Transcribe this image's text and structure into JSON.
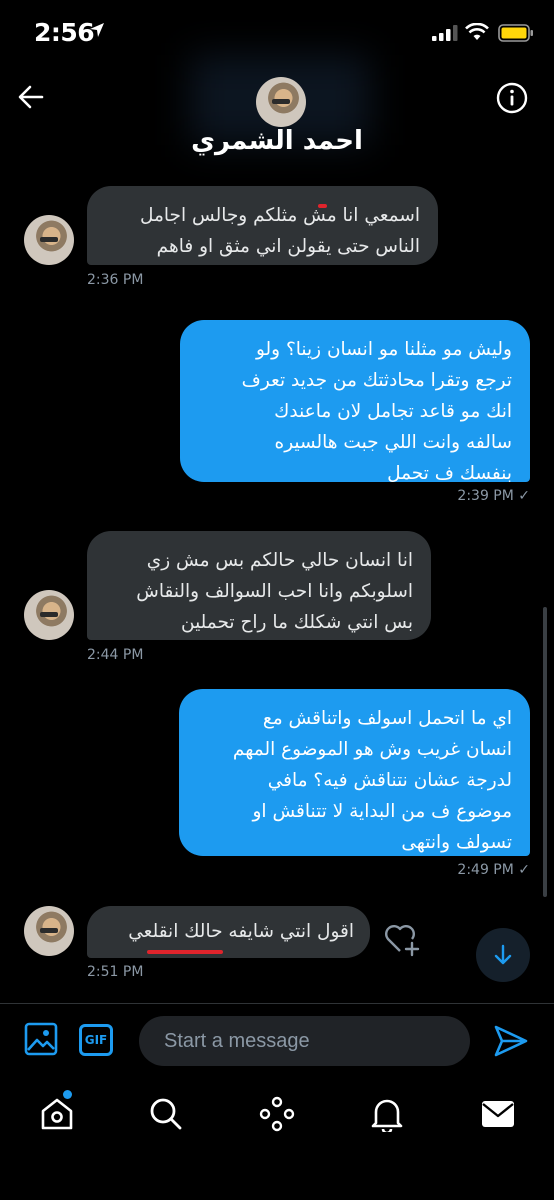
{
  "status_bar": {
    "time": "2:56"
  },
  "header": {
    "name": "احمد الشمري"
  },
  "messages": [
    {
      "side": "received",
      "text": "اسمعي انا مش مثلكم وجالس اجامل\nالناس حتى يقولن اني مثق او فاهم",
      "time": "2:36 PM"
    },
    {
      "side": "sent",
      "text": "وليش مو مثلنا مو انسان زينا؟ ولو\nترجع وتقرا محادثتك من جديد تعرف\nانك مو قاعد تجامل لان ماعندك\nسالفه وانت اللي جبت هالسيره\nبنفسك ف تحمل",
      "time": "2:39 PM ✓"
    },
    {
      "side": "received",
      "text": "انا انسان حالي حالكم بس مش زي\nاسلوبكم وانا احب السوالف والنقاش\nبس انتي شكلك ما راح تحملين",
      "time": "2:44 PM"
    },
    {
      "side": "sent",
      "text": "اي ما اتحمل اسولف واتناقش مع\nانسان غريب وش هو الموضوع المهم\nلدرجة عشان نتناقش فيه؟ مافي\nموضوع ف من البداية لا تتناقش او\nتسولف وانتهى",
      "time": "2:49 PM ✓"
    },
    {
      "side": "received",
      "text": "اقول انتي شايفه حالك انقلعي",
      "time": "2:51 PM"
    }
  ],
  "composer": {
    "placeholder": "Start a message",
    "gif_label": "GIF"
  },
  "tabs": [
    "home-icon",
    "search-icon",
    "spaces-icon",
    "notifications-icon",
    "messages-icon"
  ],
  "colors": {
    "accent": "#1d9bf0",
    "received_bubble": "#2f3336",
    "annotation": "#e0242c"
  }
}
